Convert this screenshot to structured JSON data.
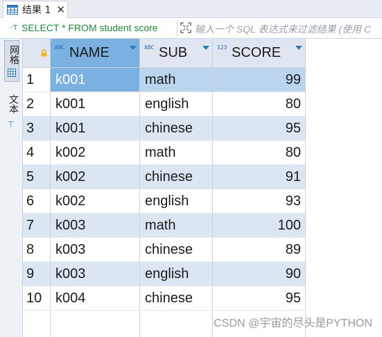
{
  "tab": {
    "label": "结果 1",
    "close": "✕"
  },
  "filter": {
    "sql": "SELECT * FROM student  score",
    "placeholder": "输入一个 SQL 表达式来过滤结果 (使用 C"
  },
  "side": {
    "grid_label": "网格",
    "text_label": "文本"
  },
  "columns": [
    {
      "type": "ABC",
      "label": "NAME"
    },
    {
      "type": "ABC",
      "label": "SUB"
    },
    {
      "type": "123",
      "label": "SCORE"
    }
  ],
  "rows": [
    {
      "n": "1",
      "name": "k001",
      "sub": "math",
      "score": "99"
    },
    {
      "n": "2",
      "name": "k001",
      "sub": "english",
      "score": "80"
    },
    {
      "n": "3",
      "name": "k001",
      "sub": "chinese",
      "score": "95"
    },
    {
      "n": "4",
      "name": "k002",
      "sub": "math",
      "score": "80"
    },
    {
      "n": "5",
      "name": "k002",
      "sub": "chinese",
      "score": "91"
    },
    {
      "n": "6",
      "name": "k002",
      "sub": "english",
      "score": "93"
    },
    {
      "n": "7",
      "name": "k003",
      "sub": "math",
      "score": "100"
    },
    {
      "n": "8",
      "name": "k003",
      "sub": "chinese",
      "score": "89"
    },
    {
      "n": "9",
      "name": "k003",
      "sub": "english",
      "score": "90"
    },
    {
      "n": "10",
      "name": "k004",
      "sub": "chinese",
      "score": "95"
    }
  ],
  "watermark": "CSDN @宇宙的尽头是PYTHON",
  "colors": {
    "accent": "#7ab1e0",
    "alt_row": "#dce6f2",
    "sql_green": "#1f8a3a"
  }
}
